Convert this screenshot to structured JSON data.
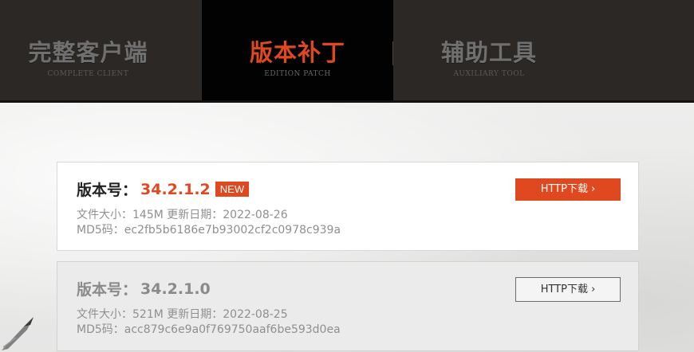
{
  "tabs": [
    {
      "title": "完整客户端",
      "subtitle": "COMPLETE CLIENT",
      "active": false
    },
    {
      "title": "版本补丁",
      "subtitle": "EDITION PATCH",
      "active": true
    },
    {
      "title": "辅助工具",
      "subtitle": "AUXILIARY TOOL",
      "active": false
    }
  ],
  "colors": {
    "accent": "#e0491f",
    "tabbar": "#2b2825",
    "active_tab": "#020202"
  },
  "patches": [
    {
      "version_label": "版本号：",
      "version": "34.2.1.2",
      "badge": "NEW",
      "size_line": "文件大小：145M 更新日期：2022-08-26",
      "md5_line": "MD5码：ec2fb5b6186e7b93002cf2c0978c939a",
      "download_label": "HTTP下载 ›"
    },
    {
      "version_label": "版本号：",
      "version": "34.2.1.0",
      "size_line": "文件大小：521M 更新日期：2022-08-25",
      "md5_line": "MD5码：acc879c6e9a0f769750aaf6be593d0ea",
      "download_label": "HTTP下载 ›"
    }
  ],
  "icons": {
    "decoration": "brush-stroke-icon"
  }
}
